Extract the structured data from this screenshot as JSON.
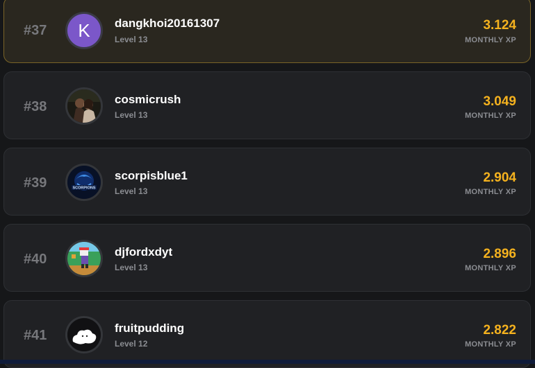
{
  "leaderboard": {
    "rows": [
      {
        "rank": "#37",
        "avatar_letter": "K",
        "name": "dangkhoi20161307",
        "level": "Level 13",
        "xp": "3.124",
        "xp_label": "MONTHLY XP"
      },
      {
        "rank": "#38",
        "avatar_icon": "couple-photo-avatar-icon",
        "name": "cosmicrush",
        "level": "Level 13",
        "xp": "3.049",
        "xp_label": "MONTHLY XP"
      },
      {
        "rank": "#39",
        "avatar_icon": "scorpion-logo-avatar-icon",
        "avatar_text": "SCORPIONS",
        "name": "scorpisblue1",
        "level": "Level 13",
        "xp": "2.904",
        "xp_label": "MONTHLY XP"
      },
      {
        "rank": "#40",
        "avatar_icon": "pixel-character-avatar-icon",
        "name": "djfordxdyt",
        "level": "Level 13",
        "xp": "2.896",
        "xp_label": "MONTHLY XP"
      },
      {
        "rank": "#41",
        "avatar_icon": "cloud-sketch-avatar-icon",
        "name": "fruitpudding",
        "level": "Level 12",
        "xp": "2.822",
        "xp_label": "MONTHLY XP"
      }
    ]
  },
  "colors": {
    "highlight_border": "#7a6427",
    "xp_gold": "#f5b21e",
    "avatar_purple": "#7b57c9"
  }
}
